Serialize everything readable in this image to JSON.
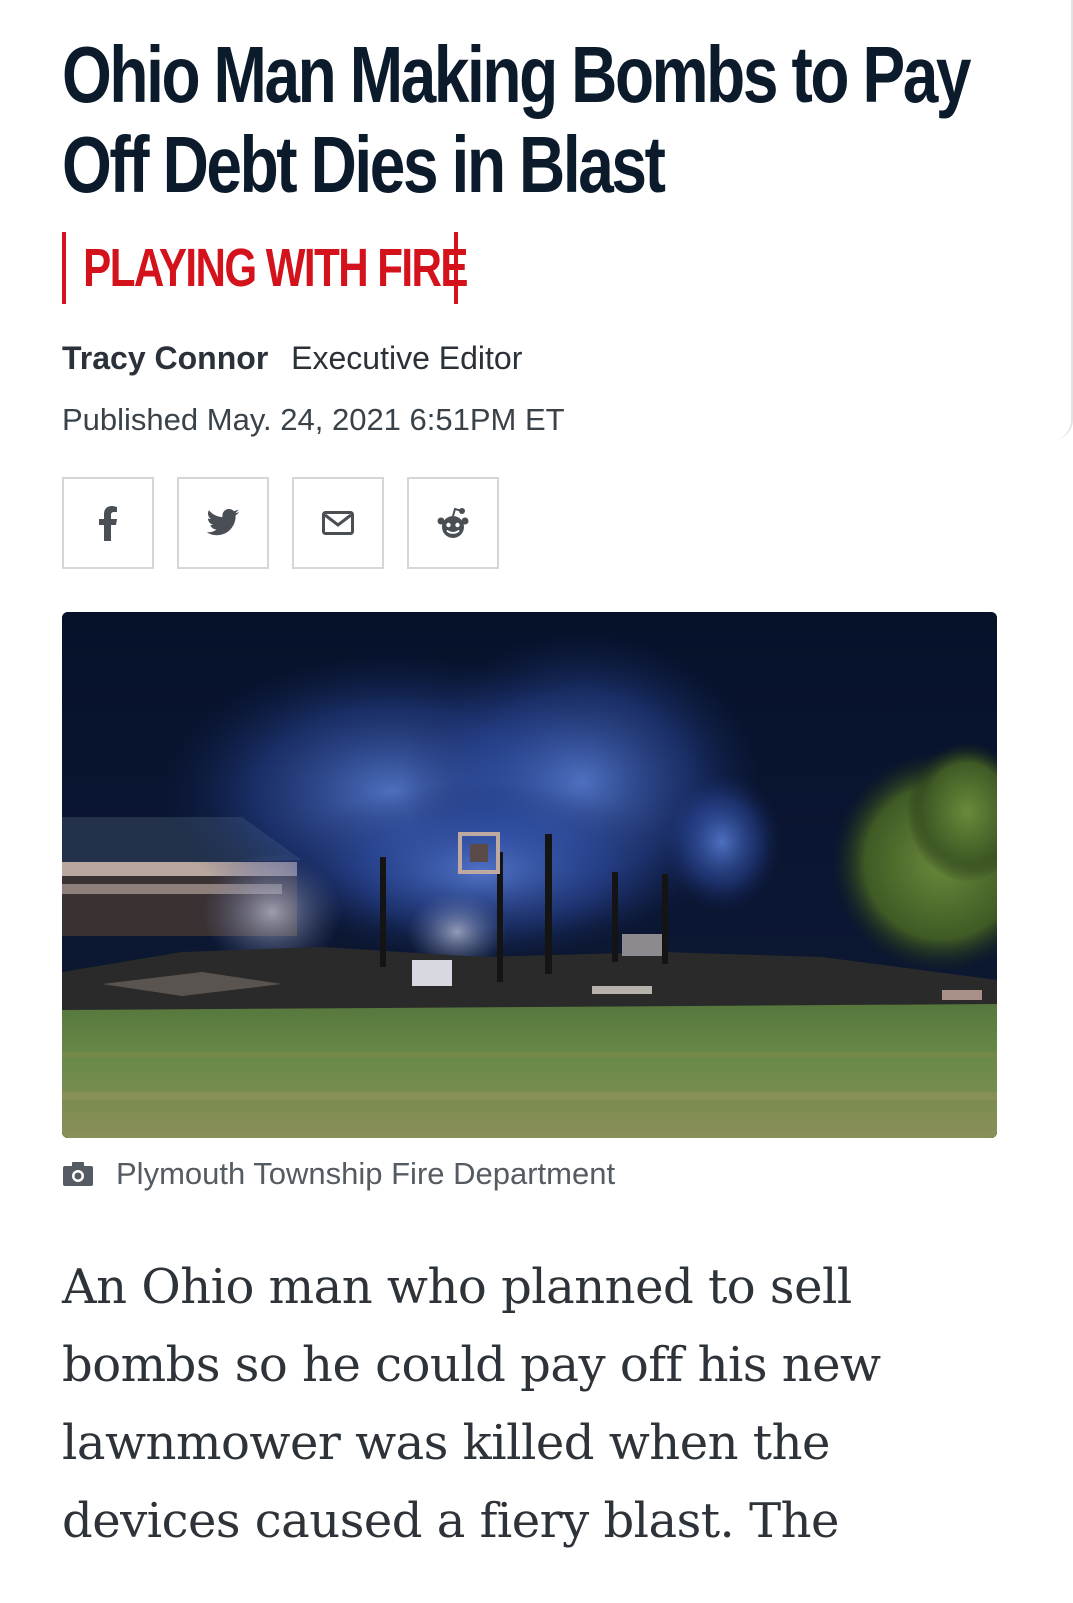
{
  "article": {
    "headline": "Ohio Man Making Bombs to Pay Off Debt Dies in Blast",
    "kicker": "PLAYING WITH FIRE",
    "author": "Tracy Connor",
    "author_role": "Executive Editor",
    "published": "Published May. 24, 2021 6:51PM ET",
    "photo_credit": "Plymouth Township Fire Department",
    "lede": "An Ohio man who planned to sell bombs so he could pay off his new lawnmower was killed when the devices caused a fiery blast. The"
  },
  "share": [
    {
      "name": "facebook",
      "icon": "facebook-icon"
    },
    {
      "name": "twitter",
      "icon": "twitter-icon"
    },
    {
      "name": "email",
      "icon": "mail-icon"
    },
    {
      "name": "reddit",
      "icon": "reddit-icon"
    }
  ],
  "colors": {
    "headline": "#0b1b2b",
    "kicker": "#d4121b",
    "body_text": "#2d3339",
    "share_border": "#d6d6d6"
  }
}
